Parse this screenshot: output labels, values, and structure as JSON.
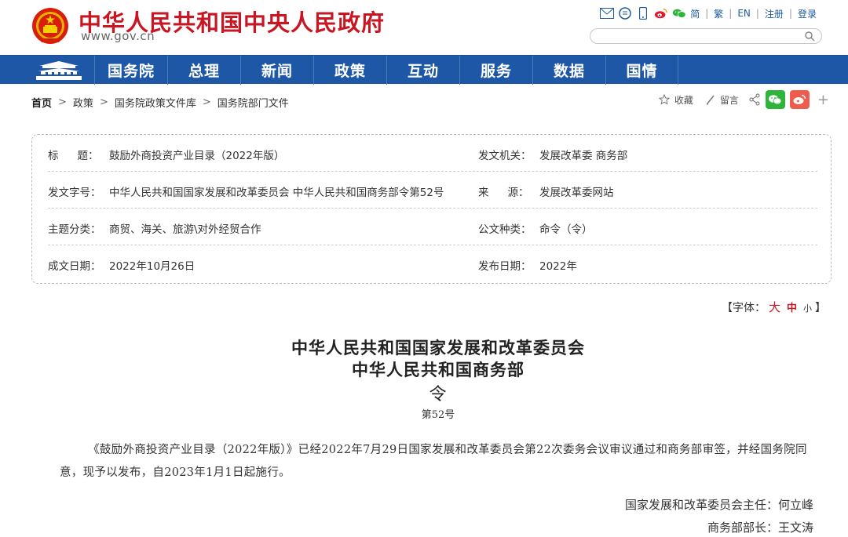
{
  "header": {
    "title": "中华人民共和国中央人民政府",
    "url": "www.gov.cn",
    "tools": {
      "simplified": "简",
      "traditional": "繁",
      "english": "EN",
      "register": "注册",
      "login": "登录"
    },
    "search_placeholder": "",
    "icons": [
      "mail-icon",
      "chat-icon",
      "mobile-icon",
      "weibo-icon",
      "wechat-icon"
    ]
  },
  "nav": {
    "items": [
      {
        "label": "国务院"
      },
      {
        "label": "总理"
      },
      {
        "label": "新闻"
      },
      {
        "label": "政策"
      },
      {
        "label": "互动"
      },
      {
        "label": "服务"
      },
      {
        "label": "数据"
      },
      {
        "label": "国情"
      }
    ],
    "bg_color": "#1d57a6"
  },
  "breadcrumb": [
    "首页",
    "政策",
    "国务院政策文件库",
    "国务院部门文件"
  ],
  "share": {
    "favorite": "收藏",
    "comment": "留言"
  },
  "info": {
    "title_label_a": "标",
    "title_label_b": "题：",
    "title_value": "鼓励外商投资产业目录（2022年版）",
    "issuer_label": "发文机关：",
    "issuer_value": "发展改革委  商务部",
    "docno_label": "发文字号：",
    "docno_value": "中华人民共和国国家发展和改革委员会  中华人民共和国商务部令第52号",
    "source_label_a": "来",
    "source_label_b": "源：",
    "source_value": "发展改革委网站",
    "topic_label": "主题分类：",
    "topic_value": "商贸、海关、旅游\\对外经贸合作",
    "type_label": "公文种类：",
    "type_value": "命令（令）",
    "date_label": "成文日期：",
    "date_value": "2022年10月26日",
    "pub_label": "发布日期：",
    "pub_value": "2022年"
  },
  "font_control": {
    "prefix": "【字体：",
    "large": "大",
    "medium": "中",
    "small": "小",
    "suffix": "】"
  },
  "article": {
    "title_line1": "中华人民共和国国家发展和改革委员会",
    "title_line2": "中华人民共和国商务部",
    "title_line3": "令",
    "doc_number": "第52号",
    "body": "《鼓励外商投资产业目录（2022年版）》已经2022年7月29日国家发展和改革委员会第22次委务会议审议通过和商务部审签，并经国务院同意，现予以发布，自2023年1月1日起施行。",
    "sign1": "国家发展和改革委员会主任：何立峰",
    "sign2": "商务部部长：王文涛"
  }
}
